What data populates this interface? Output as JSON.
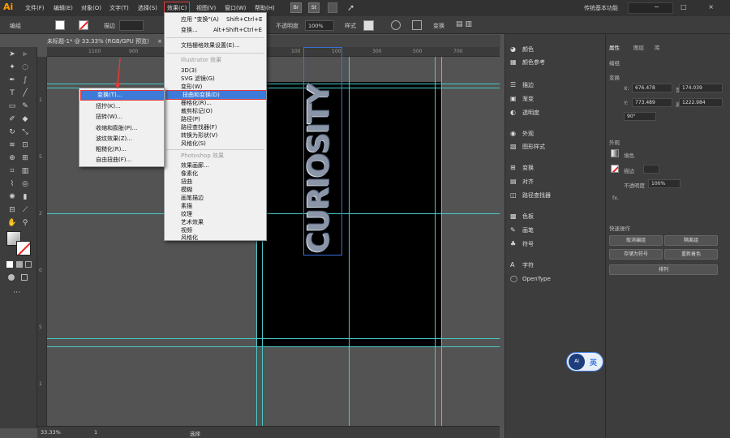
{
  "menubar": {
    "logo": "Ai",
    "items": [
      "文件(F)",
      "编辑(E)",
      "对象(O)",
      "文字(T)",
      "选择(S)",
      "效果(C)",
      "视图(V)",
      "窗口(W)",
      "帮助(H)"
    ],
    "tb_icons": [
      "Br",
      "St"
    ],
    "workspace": "传统基本功能",
    "win_controls": "− □ ×"
  },
  "controlbar": {
    "label_left": "编组",
    "stroke_label": "描边",
    "opacity_label": "不透明度",
    "opacity_value": "100%",
    "style_label": "样式",
    "transform_label": "变换",
    "align_icons": "▤ ▥"
  },
  "document": {
    "tab_title": "未标题-1* @ 33.33% (RGB/GPU 预览)",
    "close": "×"
  },
  "ruler": {
    "h": [
      "1200",
      "1100",
      "1000",
      "900",
      "800",
      "700",
      "600",
      "500",
      "400",
      "300",
      "200",
      "100",
      "0",
      "100",
      "200",
      "300",
      "400",
      "500",
      "600",
      "700",
      "800",
      "900",
      "1000",
      "1100",
      "1200",
      "1300"
    ],
    "v": [
      "1",
      "5",
      "2",
      "0",
      "5",
      "1"
    ]
  },
  "artboard": {
    "text": "CURIOSITY"
  },
  "status": {
    "zoom": "33.33%",
    "page": "1",
    "tool": "选择"
  },
  "effect_menu": {
    "items": [
      {
        "label": "应用 \"变换\"(A)",
        "shortcut": "Shift+Ctrl+E"
      },
      {
        "label": "变换...",
        "shortcut": "Alt+Shift+Ctrl+E"
      },
      {
        "label": "文档栅格效果设置(E)...",
        "shortcut": ""
      }
    ],
    "section_illustrator": "Illustrator 效果",
    "illustrator": [
      "3D(3)",
      "SVG 滤镜(G)",
      "变形(W)",
      "扭曲和变换(D)",
      "栅格化(R)...",
      "裁剪标记(O)",
      "路径(P)",
      "路径查找器(F)",
      "转换为形状(V)",
      "风格化(S)"
    ],
    "section_photoshop": "Photoshop 效果",
    "photoshop": [
      "效果画廊...",
      "像素化",
      "扭曲",
      "模糊",
      "画笔描边",
      "素描",
      "纹理",
      "艺术效果",
      "视频",
      "风格化"
    ]
  },
  "distort_submenu": {
    "items": [
      "变换(T)...",
      "扭拧(K)...",
      "扭转(W)...",
      "收缩和膨胀(P)...",
      "波纹效果(Z)...",
      "粗糙化(R)...",
      "自由扭曲(F)..."
    ]
  },
  "panel_dock": {
    "groups": [
      [
        "颜色",
        "颜色参考"
      ],
      [
        "描边",
        "渐变",
        "透明度"
      ],
      [
        "外观",
        "图形样式"
      ],
      [
        "变换",
        "对齐",
        "路径查找器"
      ],
      [
        "色板",
        "画笔",
        "符号"
      ],
      [
        "字符",
        "OpenType"
      ]
    ],
    "icons": [
      "palette-icon",
      "color-guide-icon",
      "stroke-icon",
      "gradient-icon",
      "transparency-icon",
      "appearance-icon",
      "graphic-styles-icon",
      "transform-icon",
      "align-icon",
      "pathfinder-icon",
      "swatches-icon",
      "brushes-icon",
      "symbols-icon",
      "character-icon",
      "opentype-icon"
    ]
  },
  "properties": {
    "tabs": [
      "属性",
      "图层",
      "库"
    ],
    "section_group": "编组",
    "section_transform": "变换",
    "x_label": "X:",
    "x_value": "676.478",
    "y_label": "Y:",
    "y_value": "773.489",
    "w_label": "宽:",
    "w_value": "174.039",
    "h_label": "高:",
    "h_value": "1222.984",
    "angle_value": "90°",
    "section_appearance": "外观",
    "fill_label": "填色",
    "stroke_label": "描边",
    "opacity_label": "不透明度",
    "opacity_value": "100%",
    "fx_label": "fx.",
    "section_quick": "快速操作",
    "buttons": [
      "取消编组",
      "隔离组",
      "存储为符号",
      "重新着色",
      "排列"
    ]
  },
  "ime": {
    "icon_text": "AI",
    "label": "英"
  },
  "colors": {
    "accent": "#3e7bd8",
    "guide": "#49c9c9",
    "highlight_box": "#e23b3b"
  }
}
